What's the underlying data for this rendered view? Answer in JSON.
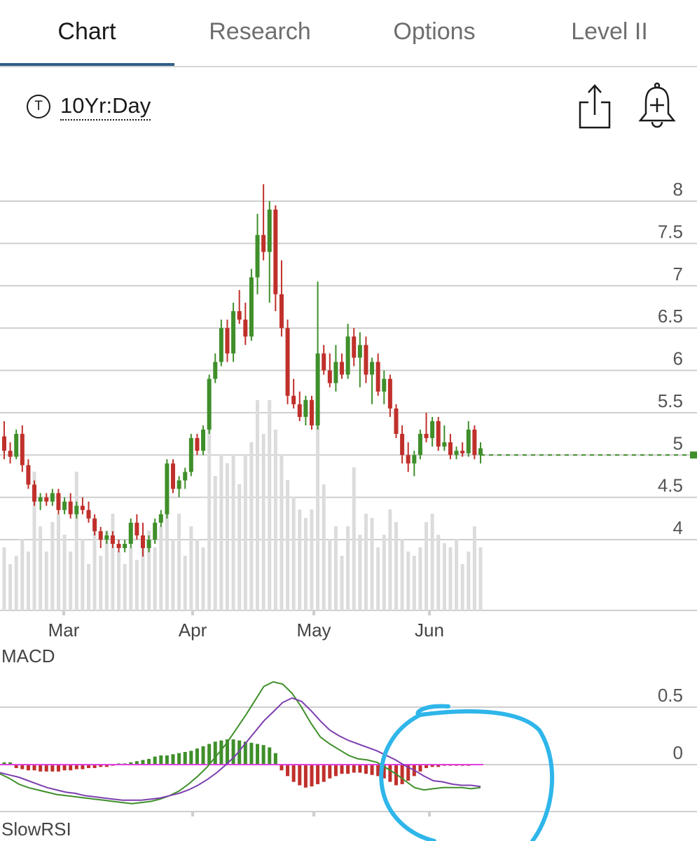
{
  "tabs": [
    {
      "label": "Chart",
      "active": true
    },
    {
      "label": "Research",
      "active": false
    },
    {
      "label": "Options",
      "active": false
    },
    {
      "label": "Level II",
      "active": false
    }
  ],
  "toolbar": {
    "range_icon_letter": "T",
    "range_label": "10Yr:Day",
    "share_icon": "share-icon",
    "alert_icon": "bell-plus-icon"
  },
  "colors": {
    "accent": "#2f5f87",
    "up": "#3f8f2a",
    "down": "#c0302b",
    "volume": "#dcdcdc",
    "macd_line": "#3f8f2a",
    "signal_line": "#7d3fb0",
    "zero_line": "#e040e0",
    "annotation": "#2fb6ea"
  },
  "chart_data": [
    {
      "type": "candlestick",
      "yticks": [
        "8",
        "7.5",
        "7",
        "6.5",
        "6",
        "5.5",
        "5",
        "4.5",
        "4"
      ],
      "ylim": [
        3.5,
        8.2
      ],
      "xticks": [
        "Mar",
        "Apr",
        "May",
        "Jun"
      ],
      "last_price": 5.0,
      "grid": true,
      "candles": [
        [
          5.22,
          5.4,
          4.95,
          5.05
        ],
        [
          5.05,
          5.15,
          4.9,
          4.98
        ],
        [
          4.98,
          5.3,
          4.95,
          5.25
        ],
        [
          5.25,
          5.35,
          4.8,
          4.88
        ],
        [
          4.88,
          4.95,
          4.6,
          4.65
        ],
        [
          4.65,
          4.7,
          4.4,
          4.45
        ],
        [
          4.45,
          4.55,
          4.35,
          4.5
        ],
        [
          4.5,
          4.55,
          4.4,
          4.45
        ],
        [
          4.45,
          4.6,
          4.4,
          4.55
        ],
        [
          4.55,
          4.6,
          4.3,
          4.35
        ],
        [
          4.35,
          4.5,
          4.3,
          4.45
        ],
        [
          4.45,
          4.55,
          4.25,
          4.3
        ],
        [
          4.3,
          4.45,
          4.25,
          4.4
        ],
        [
          4.4,
          4.5,
          4.3,
          4.35
        ],
        [
          4.35,
          4.45,
          4.2,
          4.25
        ],
        [
          4.25,
          4.3,
          4.05,
          4.1
        ],
        [
          4.1,
          4.15,
          3.9,
          4.0
        ],
        [
          4.0,
          4.1,
          3.95,
          4.05
        ],
        [
          4.05,
          4.1,
          3.9,
          3.95
        ],
        [
          3.95,
          4.0,
          3.85,
          3.9
        ],
        [
          3.9,
          4.0,
          3.85,
          3.95
        ],
        [
          3.95,
          4.25,
          3.9,
          4.2
        ],
        [
          4.2,
          4.3,
          4.0,
          4.05
        ],
        [
          4.05,
          4.2,
          3.8,
          3.9
        ],
        [
          3.9,
          4.05,
          3.85,
          4.0
        ],
        [
          4.0,
          4.25,
          3.95,
          4.2
        ],
        [
          4.2,
          4.35,
          4.15,
          4.3
        ],
        [
          4.3,
          4.95,
          4.25,
          4.9
        ],
        [
          4.9,
          4.95,
          4.55,
          4.6
        ],
        [
          4.6,
          4.75,
          4.5,
          4.7
        ],
        [
          4.7,
          4.85,
          4.6,
          4.8
        ],
        [
          4.8,
          5.25,
          4.75,
          5.2
        ],
        [
          5.2,
          5.25,
          5.0,
          5.05
        ],
        [
          5.05,
          5.35,
          5.0,
          5.3
        ],
        [
          5.3,
          5.95,
          5.25,
          5.9
        ],
        [
          5.9,
          6.2,
          5.85,
          6.1
        ],
        [
          6.1,
          6.6,
          6.05,
          6.5
        ],
        [
          6.5,
          6.6,
          6.1,
          6.2
        ],
        [
          6.2,
          6.8,
          6.1,
          6.7
        ],
        [
          6.7,
          6.95,
          6.55,
          6.6
        ],
        [
          6.6,
          6.8,
          6.3,
          6.4
        ],
        [
          6.4,
          7.2,
          6.35,
          7.1
        ],
        [
          7.1,
          7.85,
          6.9,
          7.6
        ],
        [
          7.6,
          8.2,
          7.3,
          7.4
        ],
        [
          7.4,
          8.0,
          6.8,
          7.9
        ],
        [
          7.9,
          7.95,
          6.7,
          6.9
        ],
        [
          6.9,
          7.3,
          6.4,
          6.5
        ],
        [
          6.5,
          6.6,
          5.6,
          5.7
        ],
        [
          5.7,
          5.9,
          5.55,
          5.6
        ],
        [
          5.6,
          5.75,
          5.4,
          5.45
        ],
        [
          5.45,
          5.7,
          5.35,
          5.65
        ],
        [
          5.65,
          5.7,
          5.3,
          5.35
        ],
        [
          5.35,
          7.05,
          5.3,
          6.2
        ],
        [
          6.2,
          6.3,
          5.95,
          6.0
        ],
        [
          6.0,
          6.2,
          5.8,
          5.85
        ],
        [
          5.85,
          6.3,
          5.75,
          6.1
        ],
        [
          6.1,
          6.2,
          5.9,
          5.95
        ],
        [
          5.95,
          6.55,
          5.9,
          6.4
        ],
        [
          6.4,
          6.5,
          6.05,
          6.15
        ],
        [
          6.15,
          6.45,
          5.8,
          6.3
        ],
        [
          6.3,
          6.4,
          5.85,
          5.95
        ],
        [
          5.95,
          6.15,
          5.6,
          6.1
        ],
        [
          6.1,
          6.2,
          5.7,
          5.75
        ],
        [
          5.75,
          6.0,
          5.6,
          5.9
        ],
        [
          5.9,
          5.95,
          5.45,
          5.55
        ],
        [
          5.55,
          5.6,
          5.2,
          5.25
        ],
        [
          5.25,
          5.35,
          4.9,
          5.0
        ],
        [
          5.0,
          5.15,
          4.8,
          4.9
        ],
        [
          4.9,
          5.05,
          4.75,
          5.0
        ],
        [
          5.0,
          5.3,
          4.95,
          5.25
        ],
        [
          5.25,
          5.5,
          5.15,
          5.2
        ],
        [
          5.2,
          5.45,
          5.1,
          5.4
        ],
        [
          5.4,
          5.45,
          5.05,
          5.1
        ],
        [
          5.1,
          5.35,
          5.05,
          5.15
        ],
        [
          5.15,
          5.25,
          4.95,
          5.0
        ],
        [
          5.0,
          5.1,
          4.95,
          5.05
        ],
        [
          5.05,
          5.15,
          4.98,
          5.02
        ],
        [
          5.02,
          5.4,
          4.98,
          5.3
        ],
        [
          5.3,
          5.35,
          4.95,
          5.0
        ],
        [
          5.0,
          5.15,
          4.9,
          5.08
        ]
      ],
      "volume": [
        0.3,
        0.22,
        0.26,
        0.34,
        0.28,
        0.66,
        0.4,
        0.28,
        0.42,
        0.46,
        0.36,
        0.28,
        0.66,
        0.34,
        0.22,
        0.42,
        0.26,
        0.38,
        0.46,
        0.28,
        0.22,
        0.3,
        0.24,
        0.34,
        0.38,
        0.3,
        0.4,
        0.68,
        0.34,
        0.46,
        0.26,
        0.4,
        0.34,
        0.3,
        0.9,
        0.64,
        0.74,
        0.7,
        0.74,
        0.6,
        0.74,
        0.8,
        1.0,
        0.84,
        1.0,
        0.86,
        0.74,
        0.62,
        0.54,
        0.48,
        0.44,
        0.48,
        1.0,
        0.6,
        0.34,
        0.4,
        0.26,
        0.4,
        0.68,
        0.36,
        0.46,
        0.44,
        0.3,
        0.36,
        0.48,
        0.42,
        0.34,
        0.28,
        0.26,
        0.3,
        0.42,
        0.46,
        0.36,
        0.32,
        0.3,
        0.34,
        0.22,
        0.28,
        0.4,
        0.3
      ]
    },
    {
      "type": "line",
      "title": "MACD",
      "yticks": [
        "0.5",
        "0"
      ],
      "ylim": [
        -0.45,
        0.75
      ],
      "series": [
        {
          "name": "",
          "values": [
            -0.08,
            -0.12,
            -0.17,
            -0.2,
            -0.22,
            -0.24,
            -0.26,
            -0.27,
            -0.28,
            -0.29,
            -0.3,
            -0.31,
            -0.32,
            -0.33,
            -0.34,
            -0.33,
            -0.32,
            -0.3,
            -0.27,
            -0.23,
            -0.17,
            -0.1,
            -0.02,
            0.08,
            0.18,
            0.3,
            0.42,
            0.55,
            0.68,
            0.72,
            0.7,
            0.62,
            0.5,
            0.36,
            0.24,
            0.18,
            0.13,
            0.08,
            0.05,
            0.04,
            0.02,
            -0.03,
            -0.08,
            -0.14,
            -0.2,
            -0.22,
            -0.21,
            -0.2,
            -0.2,
            -0.2,
            -0.21,
            -0.2
          ]
        },
        {
          "name": "",
          "values": [
            -0.07,
            -0.09,
            -0.11,
            -0.14,
            -0.17,
            -0.2,
            -0.22,
            -0.24,
            -0.25,
            -0.27,
            -0.28,
            -0.29,
            -0.3,
            -0.31,
            -0.31,
            -0.31,
            -0.3,
            -0.29,
            -0.27,
            -0.25,
            -0.22,
            -0.18,
            -0.13,
            -0.07,
            0.0,
            0.08,
            0.18,
            0.28,
            0.38,
            0.46,
            0.54,
            0.58,
            0.55,
            0.47,
            0.38,
            0.3,
            0.25,
            0.21,
            0.18,
            0.15,
            0.12,
            0.08,
            0.04,
            -0.01,
            -0.05,
            -0.1,
            -0.14,
            -0.15,
            -0.17,
            -0.18,
            -0.18,
            -0.19
          ]
        }
      ],
      "histogram": [
        0.02,
        0.02,
        -0.03,
        -0.04,
        -0.05,
        -0.05,
        -0.06,
        -0.06,
        -0.06,
        -0.06,
        -0.05,
        -0.05,
        -0.04,
        -0.04,
        -0.03,
        -0.03,
        -0.02,
        -0.02,
        -0.01,
        0.01,
        0.01,
        0.02,
        0.03,
        0.04,
        0.05,
        0.07,
        0.08,
        0.08,
        0.09,
        0.1,
        0.11,
        0.12,
        0.14,
        0.16,
        0.18,
        0.2,
        0.21,
        0.22,
        0.22,
        0.21,
        0.2,
        0.19,
        0.18,
        0.17,
        0.15,
        0.1,
        -0.05,
        -0.1,
        -0.15,
        -0.18,
        -0.2,
        -0.19,
        -0.17,
        -0.15,
        -0.12,
        -0.1,
        -0.08,
        -0.08,
        -0.07,
        -0.07,
        -0.08,
        -0.09,
        -0.1,
        -0.12,
        -0.15,
        -0.18,
        -0.17,
        -0.14,
        -0.1,
        -0.06,
        -0.03,
        -0.02,
        -0.02,
        -0.01,
        -0.01,
        -0.01,
        -0.01,
        -0.01,
        0.0,
        0.0
      ]
    }
  ],
  "lower_indicator_label": "SlowRSI"
}
